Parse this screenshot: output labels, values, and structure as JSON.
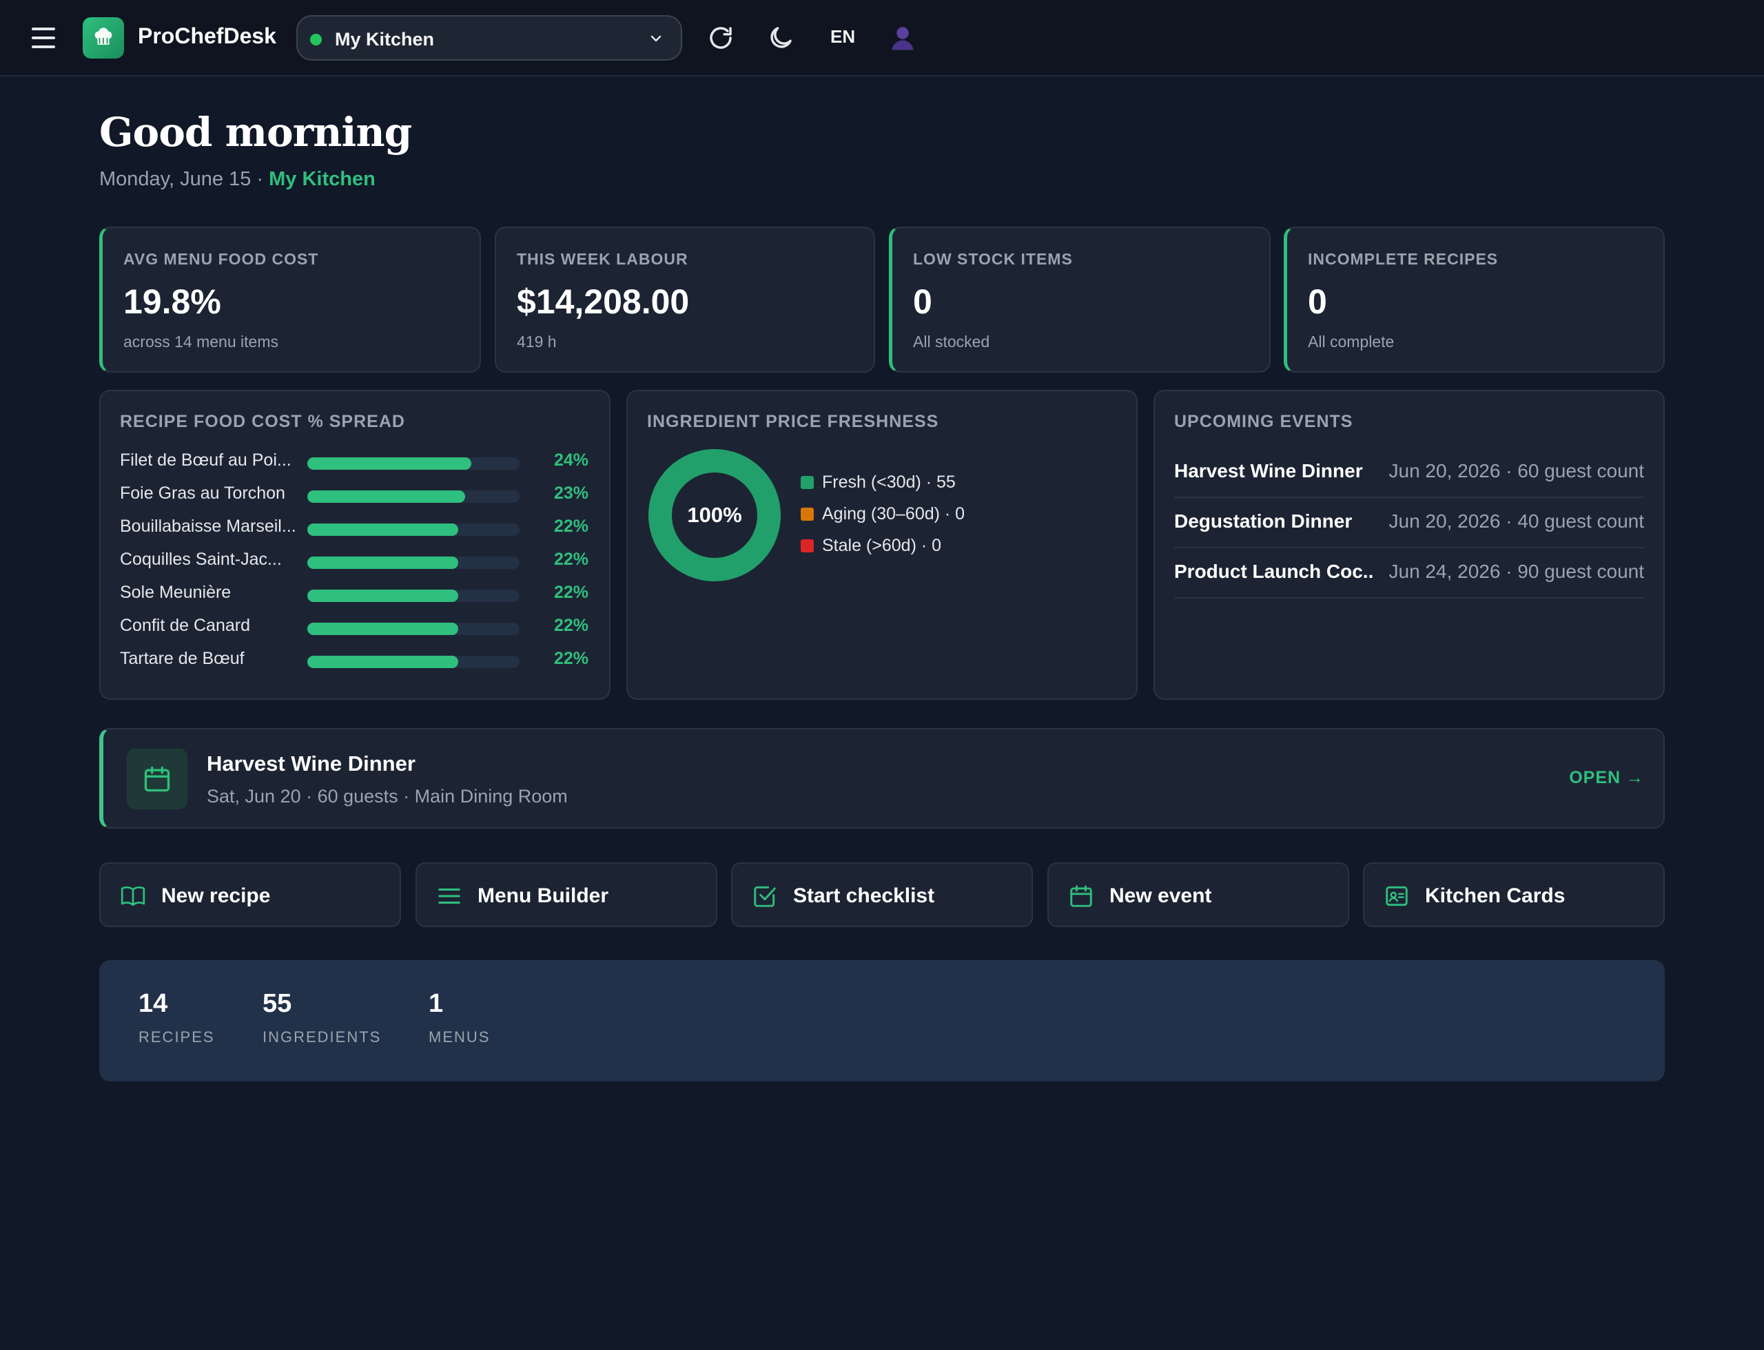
{
  "app": {
    "brand": "ProChefDesk",
    "kitchen_selector": "My Kitchen",
    "language": "EN"
  },
  "greeting": {
    "title": "Good morning",
    "date": "Monday, June 15",
    "separator": " · ",
    "kitchen": "My Kitchen"
  },
  "kpis": [
    {
      "label": "AVG MENU FOOD COST",
      "value": "19.8%",
      "sub": "across 14 menu items"
    },
    {
      "label": "THIS WEEK LABOUR",
      "value": "$14,208.00",
      "sub": "419 h"
    },
    {
      "label": "LOW STOCK ITEMS",
      "value": "0",
      "sub": "All stocked"
    },
    {
      "label": "INCOMPLETE RECIPES",
      "value": "0",
      "sub": "All complete"
    }
  ],
  "food_cost_panel": {
    "title": "RECIPE FOOD COST % SPREAD",
    "rows": [
      {
        "name": "Filet de Bœuf au Poi...",
        "pct_label": "24%",
        "value": 24
      },
      {
        "name": "Foie Gras au Torchon",
        "pct_label": "23%",
        "value": 23
      },
      {
        "name": "Bouillabaisse Marseil...",
        "pct_label": "22%",
        "value": 22
      },
      {
        "name": "Coquilles Saint-Jac...",
        "pct_label": "22%",
        "value": 22
      },
      {
        "name": "Sole Meunière",
        "pct_label": "22%",
        "value": 22
      },
      {
        "name": "Confit de Canard",
        "pct_label": "22%",
        "value": 22
      },
      {
        "name": "Tartare de Bœuf",
        "pct_label": "22%",
        "value": 22
      }
    ]
  },
  "freshness_panel": {
    "title": "INGREDIENT PRICE FRESHNESS",
    "center_label": "100%",
    "legend": [
      {
        "label": "Fresh (<30d) · 55",
        "count": 55,
        "color": "#22a06b"
      },
      {
        "label": "Aging (30–60d) · 0",
        "count": 0,
        "color": "#d97706"
      },
      {
        "label": "Stale (>60d) · 0",
        "count": 0,
        "color": "#dc2626"
      }
    ]
  },
  "events_panel": {
    "title": "UPCOMING EVENTS",
    "events": [
      {
        "name": "Harvest Wine Dinner",
        "meta": "Jun 20, 2026 · 60 guest count"
      },
      {
        "name": "Degustation Dinner",
        "meta": "Jun 20, 2026 · 40 guest count"
      },
      {
        "name": "Product Launch Coc...",
        "meta": "Jun 24, 2026 · 90 guest count"
      }
    ]
  },
  "featured_event": {
    "title": "Harvest Wine Dinner",
    "subtitle": "Sat, Jun 20 · 60 guests · Main Dining Room",
    "action": "OPEN →"
  },
  "quick_actions": [
    {
      "label": "New recipe",
      "icon": "book-icon"
    },
    {
      "label": "Menu Builder",
      "icon": "list-icon"
    },
    {
      "label": "Start checklist",
      "icon": "checkbox-icon"
    },
    {
      "label": "New event",
      "icon": "calendar-icon"
    },
    {
      "label": "Kitchen Cards",
      "icon": "id-card-icon"
    }
  ],
  "stats": [
    {
      "value": "14",
      "label": "RECIPES"
    },
    {
      "value": "55",
      "label": "INGREDIENTS"
    },
    {
      "value": "1",
      "label": "MENUS"
    }
  ],
  "colors": {
    "accent": "#2fbf7e",
    "background": "#111827",
    "card": "#1c2433",
    "stats_strip": "#22314a"
  }
}
